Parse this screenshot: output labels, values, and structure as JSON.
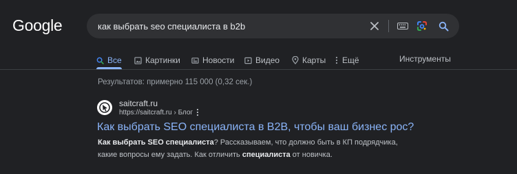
{
  "logo": {
    "text": "Google"
  },
  "search": {
    "query": "как выбрать seo специалиста в b2b",
    "clear_icon": "close-icon",
    "keyboard_icon": "keyboard-icon",
    "lens_icon": "camera-lens-icon",
    "search_icon": "search-icon"
  },
  "tabs": [
    {
      "label": "Все",
      "icon": "search-icon",
      "active": true
    },
    {
      "label": "Картинки",
      "icon": "image-icon"
    },
    {
      "label": "Новости",
      "icon": "news-icon"
    },
    {
      "label": "Видео",
      "icon": "video-icon"
    },
    {
      "label": "Карты",
      "icon": "map-pin-icon"
    },
    {
      "label": "Ещё",
      "icon": "more-vert-icon"
    }
  ],
  "tools_label": "Инструменты",
  "stats": "Результатов: примерно 115 000 (0,32 сек.)",
  "results": [
    {
      "site_name": "saitcraft.ru",
      "url": "https://saitcraft.ru › Блог",
      "title": "Как выбрать SEO специалиста в B2B, чтобы ваш бизнес рос?",
      "snippet": [
        {
          "text": "Как выбрать SEO специалиста",
          "bold": true
        },
        {
          "text": "? Рассказываем, что должно быть в КП подрядчика,",
          "bold": false
        },
        {
          "text": "какие вопросы ему задать. Как отличить ",
          "bold": false,
          "break_before": true
        },
        {
          "text": "специалиста",
          "bold": true
        },
        {
          "text": " от новичка.",
          "bold": false
        }
      ]
    }
  ],
  "colors": {
    "background": "#202124",
    "link": "#8ab4f8",
    "searchbox": "#303134",
    "muted": "#9aa0a6"
  }
}
